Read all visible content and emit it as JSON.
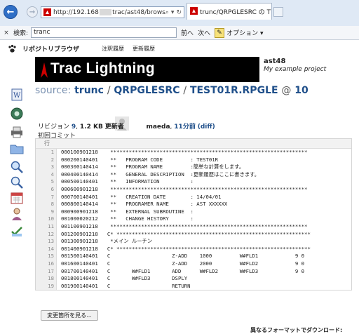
{
  "browser": {
    "url_prefix": "http://192.168",
    "url_suffix": "trac/ast48/brows",
    "tab_title": "trunc/QRPGLESRC の TE...",
    "find_label": "検索:",
    "find_value": "tranc",
    "prev_label": "前へ",
    "next_label": "次へ",
    "options_label": "オプション ▾"
  },
  "trac_nav": {
    "brand": "リポジトリブラウザ",
    "link1": "注釈履歴",
    "link2": "更新履歴"
  },
  "banner": {
    "title": "Trac Lightning",
    "project_name": "ast48",
    "project_desc": "My example project"
  },
  "path": {
    "prefix": "source:",
    "trunc": "trunc",
    "dir": "QRPGLESRC",
    "file": "TEST01R.RPGLE",
    "at": "@",
    "rev": "10"
  },
  "info": {
    "revision_label": "リビジョン",
    "revision": "9",
    "size": "1.2 KB",
    "author_label": "更新者",
    "author": "maeda",
    "age": "11分前",
    "diff": "(diff)",
    "message": "初回コミット"
  },
  "table_header": "行",
  "code_lines": [
    {
      "n": "1",
      "t": "000100901218    ****************************************************************"
    },
    {
      "n": "2",
      "t": "000200140401    **   PROGRAM CODE         : TEST01R"
    },
    {
      "n": "3",
      "t": "000300140414    **   PROGRAM NAME         :簡単な計算をします。"
    },
    {
      "n": "4",
      "t": "000400140414    **   GENERAL DESCRIPTION  :更新履歴はここに書きます。"
    },
    {
      "n": "5",
      "t": "000500140401    **   INFORMATION          :"
    },
    {
      "n": "6",
      "t": "000600901218    ****************************************************************"
    },
    {
      "n": "7",
      "t": "000700140401    **   CREATION DATE        : 14/04/01"
    },
    {
      "n": "8",
      "t": "000800140414    **   PROGRAMER NAME       : AST XXXXXX"
    },
    {
      "n": "9",
      "t": "000900901218    **   EXTERNAL SUBROUTINE  :"
    },
    {
      "n": "10",
      "t": "001000020212    **   CHANGE HISTORY       :"
    },
    {
      "n": "11",
      "t": "001100901218    ****************************************************************"
    },
    {
      "n": "12",
      "t": "001200901218   C* ***************************************************************"
    },
    {
      "n": "13",
      "t": "001300901218    *メイン ルーチン"
    },
    {
      "n": "14",
      "t": "001400901218   C* ***************************************************************"
    },
    {
      "n": "15",
      "t": "001500140401   C                    Z-ADD    1000         W#FLD1            9 0"
    },
    {
      "n": "16",
      "t": "001600140401   C                    Z-ADD    2000         W#FLD2            9 0"
    },
    {
      "n": "17",
      "t": "001700140401   C       W#FLD1       ADD      W#FLD2       W#FLD3            9 0"
    },
    {
      "n": "18",
      "t": "001800140401   C       W#FLD3       DSPLY"
    },
    {
      "n": "19",
      "t": "001900140401   C                    RETURN"
    }
  ],
  "buttons": {
    "view_changes": "変更箇所を見る..."
  },
  "footer": {
    "download": "異なるフォーマットでダウンロード:"
  }
}
